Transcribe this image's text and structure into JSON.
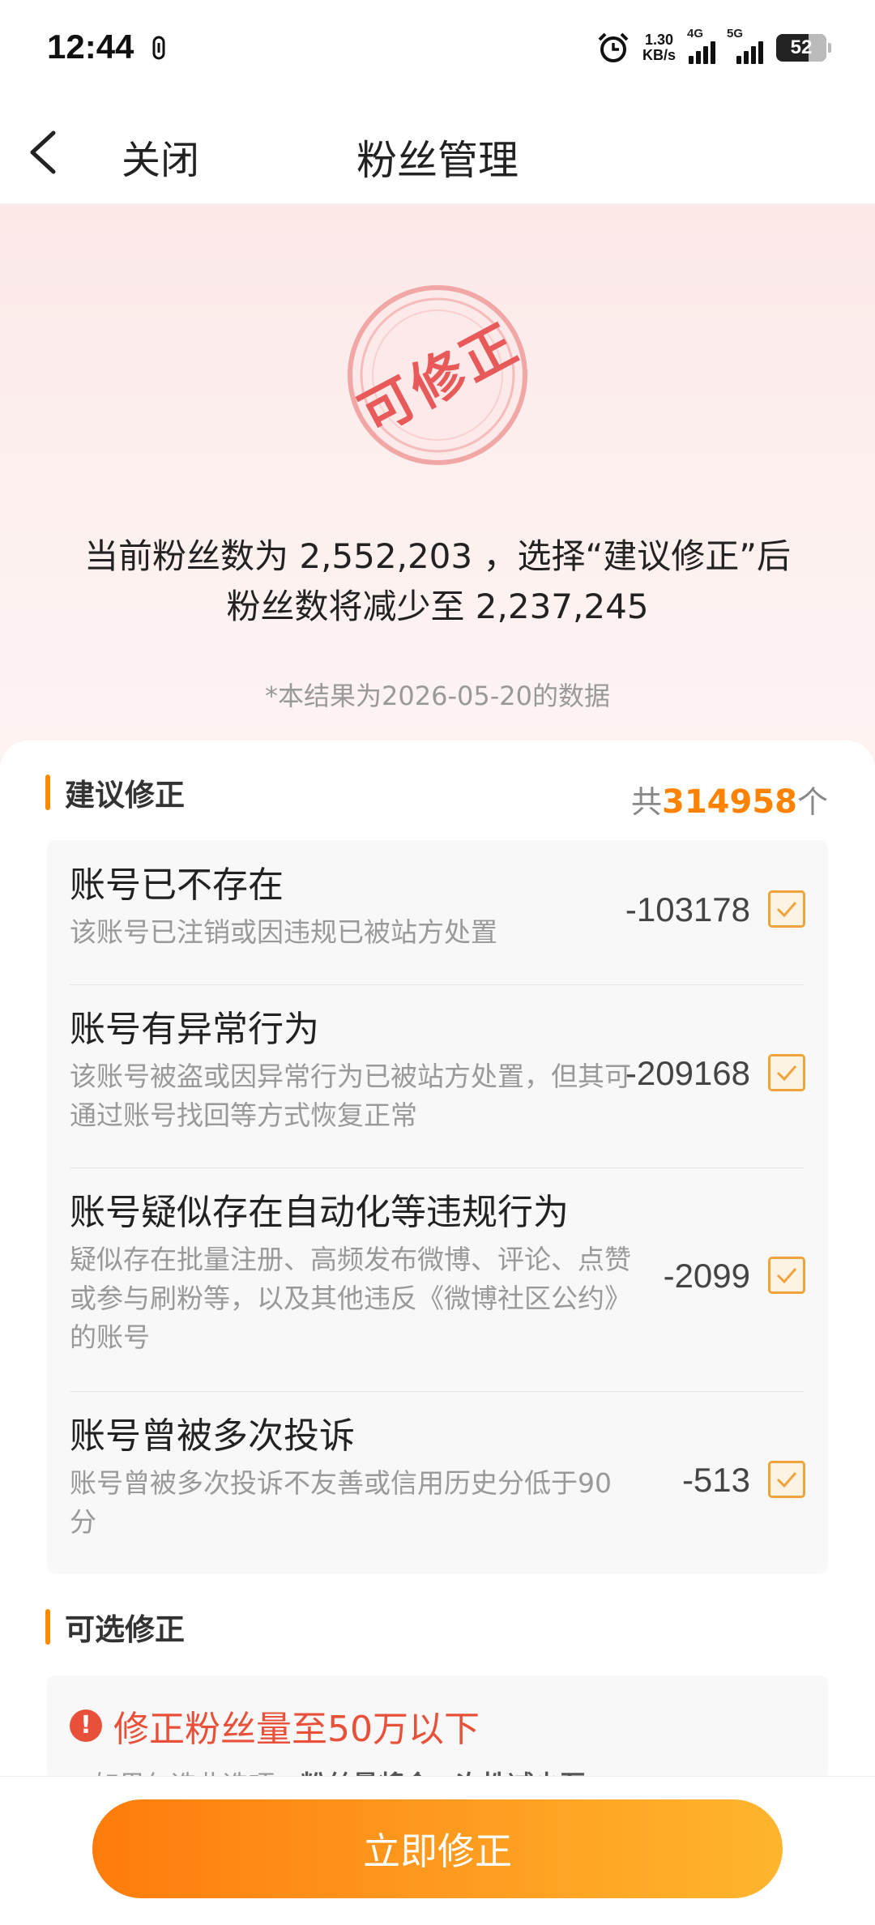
{
  "status_bar": {
    "time": "12:44",
    "speed_value": "1.30",
    "speed_unit": "KB/s",
    "net1": "4G",
    "net2": "5G",
    "battery": "52"
  },
  "nav": {
    "close_label": "关闭",
    "title": "粉丝管理"
  },
  "stamp_text": "可修正",
  "hero": {
    "line1": "当前粉丝数为 2,552,203 ，选择“建议修正”后",
    "line2": "粉丝数将减少至 2,237,245",
    "note": "*本结果为2026-05-20的数据"
  },
  "suggested": {
    "title": "建议修正",
    "total_prefix": "共",
    "total_count": "314958",
    "total_suffix": "个",
    "items": [
      {
        "title": "账号已不存在",
        "desc": "该账号已注销或因违规已被站方处置",
        "count": "-103178",
        "checked": true
      },
      {
        "title": "账号有异常行为",
        "desc": "该账号被盗或因异常行为已被站方处置，但其可通过账号找回等方式恢复正常",
        "count": "-209168",
        "checked": true
      },
      {
        "title": "账号疑似存在自动化等违规行为",
        "desc": "疑似存在批量注册、高频发布微博、评论、点赞或参与刷粉等，以及其他违反《微博社区公约》的账号",
        "count": "-2099",
        "checked": true
      },
      {
        "title": "账号曾被多次投诉",
        "desc": "账号曾被多次投诉不友善或信用历史分低于90分",
        "count": "-513",
        "checked": true
      }
    ]
  },
  "optional": {
    "title": "可选修正",
    "option_title": "修正粉丝量至50万以下",
    "option_line_prefix": "• 如果勾选此选项，",
    "option_line_bold": "粉丝量将会一次性减少至"
  },
  "bottom": {
    "button_label": "立即修正"
  },
  "colors": {
    "accent": "#ff8200",
    "warning": "#e8503a",
    "stamp": "#e85a5a"
  }
}
